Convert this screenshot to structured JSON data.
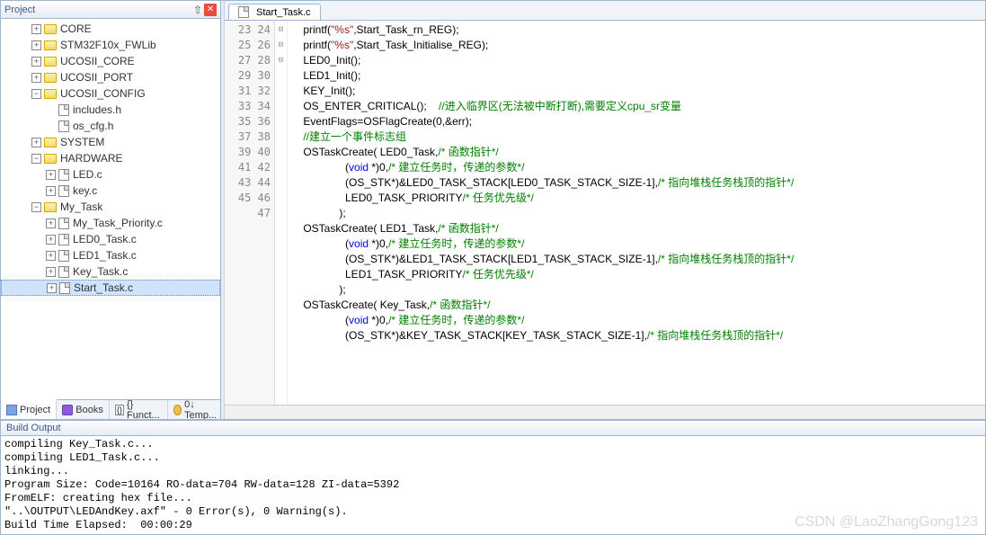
{
  "project_panel": {
    "title": "Project",
    "tree": [
      {
        "level": 2,
        "exp": "+",
        "icon": "folder",
        "label": "CORE"
      },
      {
        "level": 2,
        "exp": "+",
        "icon": "folder",
        "label": "STM32F10x_FWLib"
      },
      {
        "level": 2,
        "exp": "+",
        "icon": "folder",
        "label": "UCOSII_CORE"
      },
      {
        "level": 2,
        "exp": "+",
        "icon": "folder",
        "label": "UCOSII_PORT"
      },
      {
        "level": 2,
        "exp": "-",
        "icon": "folder",
        "label": "UCOSII_CONFIG"
      },
      {
        "level": 3,
        "exp": "",
        "icon": "file",
        "label": "includes.h"
      },
      {
        "level": 3,
        "exp": "",
        "icon": "file",
        "label": "os_cfg.h"
      },
      {
        "level": 2,
        "exp": "+",
        "icon": "folder",
        "label": "SYSTEM"
      },
      {
        "level": 2,
        "exp": "-",
        "icon": "folder",
        "label": "HARDWARE"
      },
      {
        "level": 3,
        "exp": "+",
        "icon": "file",
        "label": "LED.c"
      },
      {
        "level": 3,
        "exp": "+",
        "icon": "file",
        "label": "key.c"
      },
      {
        "level": 2,
        "exp": "-",
        "icon": "folder",
        "label": "My_Task"
      },
      {
        "level": 3,
        "exp": "+",
        "icon": "file",
        "label": "My_Task_Priority.c"
      },
      {
        "level": 3,
        "exp": "+",
        "icon": "file",
        "label": "LED0_Task.c"
      },
      {
        "level": 3,
        "exp": "+",
        "icon": "file",
        "label": "LED1_Task.c"
      },
      {
        "level": 3,
        "exp": "+",
        "icon": "file",
        "label": "Key_Task.c"
      },
      {
        "level": 3,
        "exp": "+",
        "icon": "file",
        "label": "Start_Task.c",
        "selected": true
      }
    ],
    "bottom_tabs": [
      {
        "icon": "proj",
        "label": "Project",
        "active": true
      },
      {
        "icon": "books",
        "label": "Books"
      },
      {
        "icon": "func",
        "label": "{} Funct..."
      },
      {
        "icon": "temp",
        "label": "0↓ Temp..."
      }
    ]
  },
  "editor": {
    "tab": "Start_Task.c",
    "first_line": 23,
    "fold_lines": [
      35,
      40,
      45
    ],
    "lines": [
      {
        "n": 23,
        "segs": [
          {
            "t": ""
          }
        ]
      },
      {
        "n": 24,
        "segs": [
          {
            "t": "    printf("
          },
          {
            "t": "\"%s\"",
            "c": "str"
          },
          {
            "t": ",Start_Task_rn_REG);"
          }
        ]
      },
      {
        "n": 25,
        "segs": [
          {
            "t": "    printf("
          },
          {
            "t": "\"%s\"",
            "c": "str"
          },
          {
            "t": ",Start_Task_Initialise_REG);"
          }
        ]
      },
      {
        "n": 26,
        "segs": [
          {
            "t": ""
          }
        ]
      },
      {
        "n": 27,
        "segs": [
          {
            "t": "    LED0_Init();"
          }
        ]
      },
      {
        "n": 28,
        "segs": [
          {
            "t": "    LED1_Init();"
          }
        ]
      },
      {
        "n": 29,
        "segs": [
          {
            "t": "    KEY_Init();"
          }
        ]
      },
      {
        "n": 30,
        "segs": [
          {
            "t": ""
          }
        ]
      },
      {
        "n": 31,
        "segs": [
          {
            "t": "    OS_ENTER_CRITICAL();    "
          },
          {
            "t": "//进入临界区(无法被中断打断),需要定义cpu_sr变量",
            "c": "cmt"
          }
        ]
      },
      {
        "n": 32,
        "segs": [
          {
            "t": "    EventFlags=OSFlagCreate("
          },
          {
            "t": "0",
            "c": "num"
          },
          {
            "t": ",&err);"
          }
        ]
      },
      {
        "n": 33,
        "segs": [
          {
            "t": "    "
          },
          {
            "t": "//建立一个事件标志组",
            "c": "cmt"
          }
        ]
      },
      {
        "n": 34,
        "segs": [
          {
            "t": ""
          }
        ]
      },
      {
        "n": 35,
        "segs": [
          {
            "t": "    OSTaskCreate( LED0_Task,"
          },
          {
            "t": "/* 函数指针*/",
            "c": "cmt"
          }
        ]
      },
      {
        "n": 36,
        "segs": [
          {
            "t": "                  ("
          },
          {
            "t": "void",
            "c": "kw"
          },
          {
            "t": " *)"
          },
          {
            "t": "0",
            "c": "num"
          },
          {
            "t": ","
          },
          {
            "t": "/* 建立任务时，传递的参数*/",
            "c": "cmt"
          }
        ]
      },
      {
        "n": 37,
        "segs": [
          {
            "t": "                  (OS_STK*)&LED0_TASK_STACK[LED0_TASK_STACK_SIZE-"
          },
          {
            "t": "1",
            "c": "num"
          },
          {
            "t": "],"
          },
          {
            "t": "/* 指向堆栈任务栈顶的指针*/",
            "c": "cmt"
          }
        ]
      },
      {
        "n": 38,
        "segs": [
          {
            "t": "                  LED0_TASK_PRIORITY"
          },
          {
            "t": "/* 任务优先级*/",
            "c": "cmt"
          }
        ]
      },
      {
        "n": 39,
        "segs": [
          {
            "t": "                );"
          }
        ]
      },
      {
        "n": 40,
        "segs": [
          {
            "t": "    OSTaskCreate( LED1_Task,"
          },
          {
            "t": "/* 函数指针*/",
            "c": "cmt"
          }
        ]
      },
      {
        "n": 41,
        "segs": [
          {
            "t": "                  ("
          },
          {
            "t": "void",
            "c": "kw"
          },
          {
            "t": " *)"
          },
          {
            "t": "0",
            "c": "num"
          },
          {
            "t": ","
          },
          {
            "t": "/* 建立任务时，传递的参数*/",
            "c": "cmt"
          }
        ]
      },
      {
        "n": 42,
        "segs": [
          {
            "t": "                  (OS_STK*)&LED1_TASK_STACK[LED1_TASK_STACK_SIZE-"
          },
          {
            "t": "1",
            "c": "num"
          },
          {
            "t": "],"
          },
          {
            "t": "/* 指向堆栈任务栈顶的指针*/",
            "c": "cmt"
          }
        ]
      },
      {
        "n": 43,
        "segs": [
          {
            "t": "                  LED1_TASK_PRIORITY"
          },
          {
            "t": "/* 任务优先级*/",
            "c": "cmt"
          }
        ]
      },
      {
        "n": 44,
        "segs": [
          {
            "t": "                );"
          }
        ]
      },
      {
        "n": 45,
        "segs": [
          {
            "t": "    OSTaskCreate( Key_Task,"
          },
          {
            "t": "/* 函数指针*/",
            "c": "cmt"
          }
        ]
      },
      {
        "n": 46,
        "segs": [
          {
            "t": "                  ("
          },
          {
            "t": "void",
            "c": "kw"
          },
          {
            "t": " *)"
          },
          {
            "t": "0",
            "c": "num"
          },
          {
            "t": ","
          },
          {
            "t": "/* 建立任务时，传递的参数*/",
            "c": "cmt"
          }
        ]
      },
      {
        "n": 47,
        "segs": [
          {
            "t": "                  (OS_STK*)&KEY_TASK_STACK[KEY_TASK_STACK_SIZE-"
          },
          {
            "t": "1",
            "c": "num"
          },
          {
            "t": "],"
          },
          {
            "t": "/* 指向堆栈任务栈顶的指针*/",
            "c": "cmt"
          }
        ]
      }
    ]
  },
  "output": {
    "title": "Build Output",
    "lines": [
      "compiling Key_Task.c...",
      "compiling LED1_Task.c...",
      "linking...",
      "Program Size: Code=10164 RO-data=704 RW-data=128 ZI-data=5392",
      "FromELF: creating hex file...",
      "\"..\\OUTPUT\\LEDAndKey.axf\" - 0 Error(s), 0 Warning(s).",
      "Build Time Elapsed:  00:00:29"
    ]
  },
  "watermark": "CSDN @LaoZhangGong123"
}
